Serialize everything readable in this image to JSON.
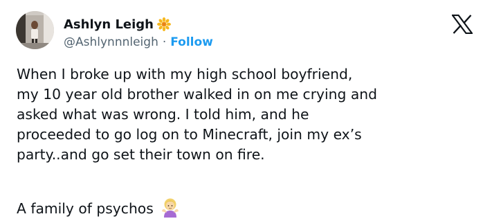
{
  "author": {
    "display_name": "Ashlyn Leigh",
    "handle": "@Ashlynnnleigh",
    "separator": "·",
    "follow_label": "Follow",
    "badge_icon": "sunflower-badge-icon",
    "follow_color": "#1d9bf0"
  },
  "platform": {
    "logo_icon": "x-logo-icon"
  },
  "tweet": {
    "lines": [
      "When I broke up with my high school boyfriend,",
      "my 10 year old brother walked in on me crying and",
      "asked what was wrong. I told him, and he",
      "proceeded to go log on to Minecraft, join my ex’s",
      "party..and go set their town on fire."
    ],
    "closing": "A family of psychos",
    "closing_emoji_icon": "woman-shrugging-emoji-icon"
  }
}
